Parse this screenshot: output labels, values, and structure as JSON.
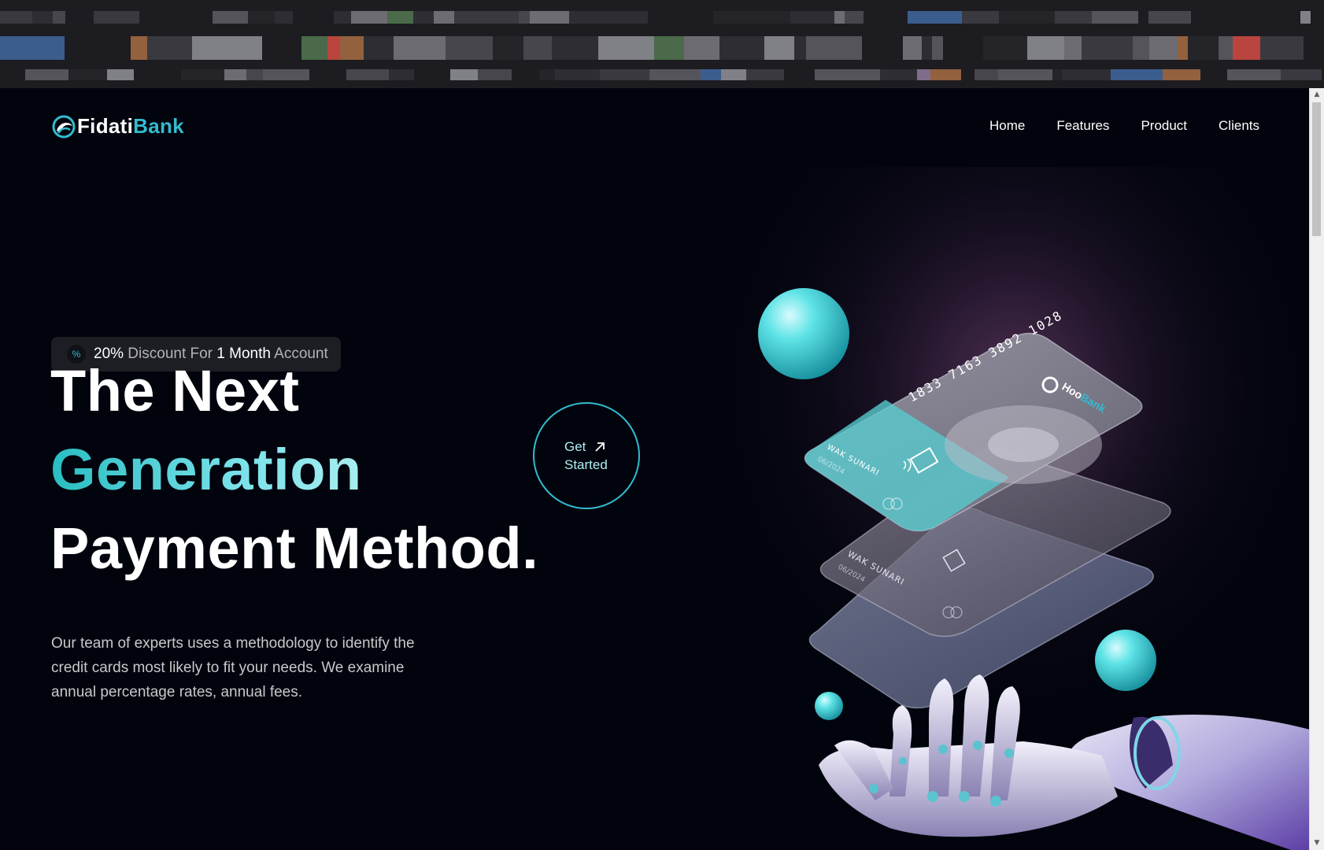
{
  "nav": {
    "logo": {
      "word1": "Fidati",
      "word2": "Bank"
    },
    "links": [
      "Home",
      "Features",
      "Product",
      "Clients"
    ]
  },
  "hero": {
    "badge": {
      "icon": "percent-icon",
      "part1": "20%",
      "part2": " Discount For ",
      "part3": "1 Month",
      "part4": " Account"
    },
    "headline": [
      "The Next",
      "Generation",
      "Payment Method."
    ],
    "paragraph": "Our team of experts uses a methodology to identify the credit cards most likely to fit your needs. We examine annual percentage rates, annual fees.",
    "cta": {
      "line1": "Get",
      "line2": "Started",
      "icon": "arrow-up-right-icon"
    }
  },
  "cards": {
    "number": "1833 7163 3892 1028",
    "brand": {
      "word1": "Hoo",
      "word2": "Bank"
    },
    "holder": "WAK SUNARI",
    "expiry": "06/2024"
  },
  "colors": {
    "background": "#02040d",
    "accent": "#33bbcf",
    "badge_bg": "#1d1e24",
    "text_muted": "#c8c8cc"
  }
}
